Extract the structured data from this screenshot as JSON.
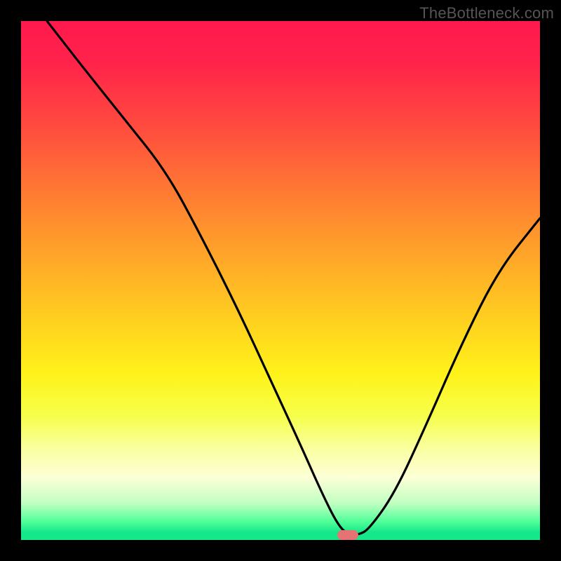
{
  "watermark": "TheBottleneck.com",
  "chart_data": {
    "type": "line",
    "title": "",
    "xlabel": "",
    "ylabel": "",
    "xlim": [
      0,
      100
    ],
    "ylim": [
      0,
      100
    ],
    "grid": false,
    "background_gradient": {
      "orientation": "vertical",
      "stops": [
        {
          "pos": 0,
          "color": "#ff194e"
        },
        {
          "pos": 0.2,
          "color": "#ff4a3f"
        },
        {
          "pos": 0.46,
          "color": "#ffa828"
        },
        {
          "pos": 0.68,
          "color": "#fff21a"
        },
        {
          "pos": 0.88,
          "color": "#fcffd6"
        },
        {
          "pos": 0.97,
          "color": "#4fff98"
        },
        {
          "pos": 1.0,
          "color": "#14e88a"
        }
      ]
    },
    "series": [
      {
        "name": "bottleneck-curve",
        "color": "#000000",
        "x": [
          5,
          12,
          20,
          28,
          35,
          42,
          48,
          54,
          58,
          61,
          63,
          65,
          67,
          72,
          78,
          85,
          92,
          100
        ],
        "y": [
          100,
          91,
          81,
          71,
          58,
          44,
          31,
          18,
          9,
          3,
          1,
          1,
          2,
          9,
          22,
          38,
          52,
          62
        ]
      }
    ],
    "marker": {
      "name": "optimal-point",
      "shape": "pill",
      "color": "#e57373",
      "x_range": [
        61,
        65
      ],
      "y": 1
    }
  }
}
